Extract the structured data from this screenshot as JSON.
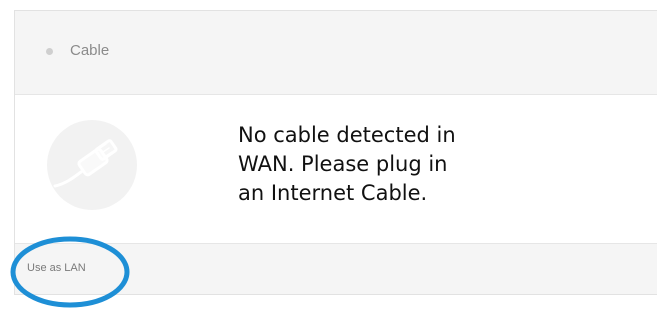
{
  "header": {
    "title": "Cable",
    "status_color": "#cfcfcf"
  },
  "body": {
    "icon": "ethernet-cable-icon",
    "message": "No cable detected in\nWAN. Please plug in\nan Internet Cable."
  },
  "footer": {
    "link_label": "Use as LAN"
  },
  "annotation": {
    "color": "#1e8fd6"
  }
}
